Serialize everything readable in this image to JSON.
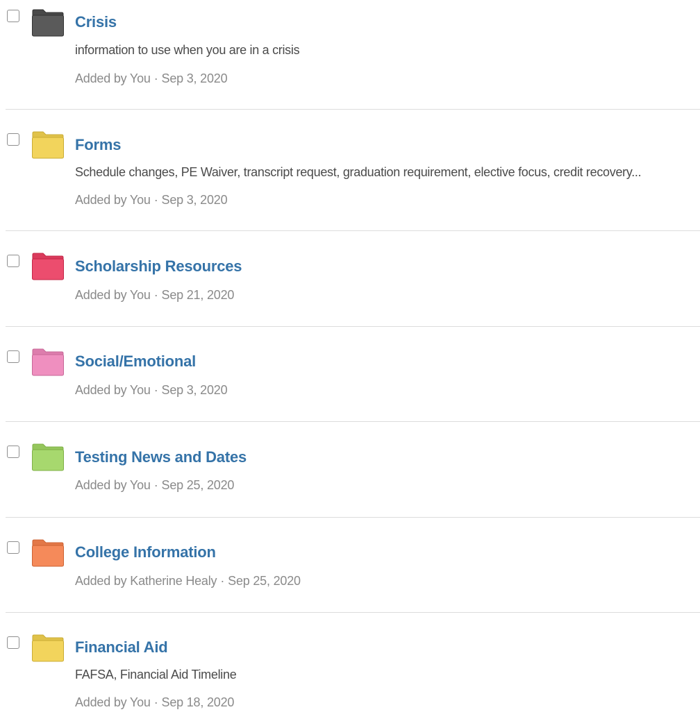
{
  "folders": [
    {
      "title": "Crisis",
      "description": "information to use when you are in a crisis",
      "added_by": "Added by You",
      "separator": "·",
      "date": "Sep 3, 2020",
      "color": "#5a5a5a",
      "icon": "folder-icon"
    },
    {
      "title": "Forms",
      "description": "Schedule changes, PE Waiver, transcript request, graduation requirement, elective focus, credit recovery...",
      "added_by": "Added by You",
      "separator": "·",
      "date": "Sep 3, 2020",
      "color": "#f2d45c",
      "icon": "folder-icon"
    },
    {
      "title": "Scholarship Resources",
      "description": "",
      "added_by": "Added by You",
      "separator": "·",
      "date": "Sep 21, 2020",
      "color": "#ec4d6e",
      "icon": "folder-icon"
    },
    {
      "title": "Social/Emotional",
      "description": "",
      "added_by": "Added by You",
      "separator": "·",
      "date": "Sep 3, 2020",
      "color": "#ef8fbf",
      "icon": "folder-icon"
    },
    {
      "title": "Testing News and Dates",
      "description": "",
      "added_by": "Added by You",
      "separator": "·",
      "date": "Sep 25, 2020",
      "color": "#a7d86e",
      "icon": "folder-icon"
    },
    {
      "title": "College Information",
      "description": "",
      "added_by": "Added by Katherine Healy",
      "separator": "·",
      "date": "Sep 25, 2020",
      "color": "#f58a5a",
      "icon": "folder-icon"
    },
    {
      "title": "Financial Aid",
      "description": "FAFSA, Financial Aid Timeline",
      "added_by": "Added by You",
      "separator": "·",
      "date": "Sep 18, 2020",
      "color": "#f2d45c",
      "icon": "folder-icon"
    }
  ]
}
